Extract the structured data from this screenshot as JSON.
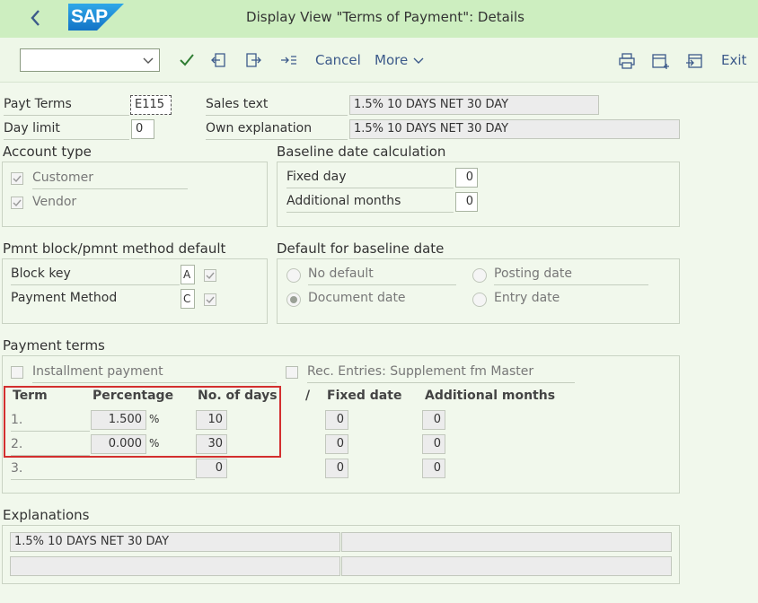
{
  "titlebar": {
    "title": "Display View \"Terms of Payment\": Details",
    "logo": "SAP"
  },
  "toolbar": {
    "cancel": "Cancel",
    "more": "More",
    "exit": "Exit"
  },
  "header": {
    "payt_terms_label": "Payt Terms",
    "payt_terms_value": "E115",
    "sales_text_label": "Sales text",
    "sales_text_value": "1.5% 10 DAYS NET 30 DAY",
    "day_limit_label": "Day limit",
    "day_limit_value": "0",
    "own_expl_label": "Own explanation",
    "own_expl_value": "1.5% 10 DAYS NET 30 DAY"
  },
  "account_type": {
    "title": "Account type",
    "customer": "Customer",
    "vendor": "Vendor"
  },
  "baseline_calc": {
    "title": "Baseline date calculation",
    "fixed_day_label": "Fixed day",
    "fixed_day_value": "0",
    "add_months_label": "Additional months",
    "add_months_value": "0"
  },
  "pmnt_block": {
    "title": "Pmnt block/pmnt method default",
    "block_key_label": "Block key",
    "block_key_value": "A",
    "payment_method_label": "Payment Method",
    "payment_method_value": "C"
  },
  "default_baseline": {
    "title": "Default for baseline date",
    "no_default": "No default",
    "document_date": "Document date",
    "posting_date": "Posting date",
    "entry_date": "Entry date"
  },
  "payment_terms": {
    "title": "Payment terms",
    "installment": "Installment payment",
    "rec_entries": "Rec. Entries: Supplement fm Master",
    "headers": {
      "term": "Term",
      "percentage": "Percentage",
      "no_of_days": "No. of days",
      "slash": "/",
      "fixed_date": "Fixed date",
      "add_months": "Additional months"
    },
    "rows": [
      {
        "term": "1.",
        "percentage": "1.500",
        "pct_sign": "%",
        "days": "10",
        "fixed": "0",
        "months": "0"
      },
      {
        "term": "2.",
        "percentage": "0.000",
        "pct_sign": "%",
        "days": "30",
        "fixed": "0",
        "months": "0"
      },
      {
        "term": "3.",
        "percentage": "",
        "pct_sign": "",
        "days": "0",
        "fixed": "0",
        "months": "0"
      }
    ]
  },
  "explanations": {
    "title": "Explanations",
    "line1": "1.5% 10 DAYS NET 30 DAY"
  },
  "colors": {
    "titlebar_bg": "#cdeec0",
    "page_bg": "#f1f8ec",
    "highlight_red": "#d32f2f",
    "link_blue": "#3c5a8a",
    "check_green": "#2e7d32"
  }
}
